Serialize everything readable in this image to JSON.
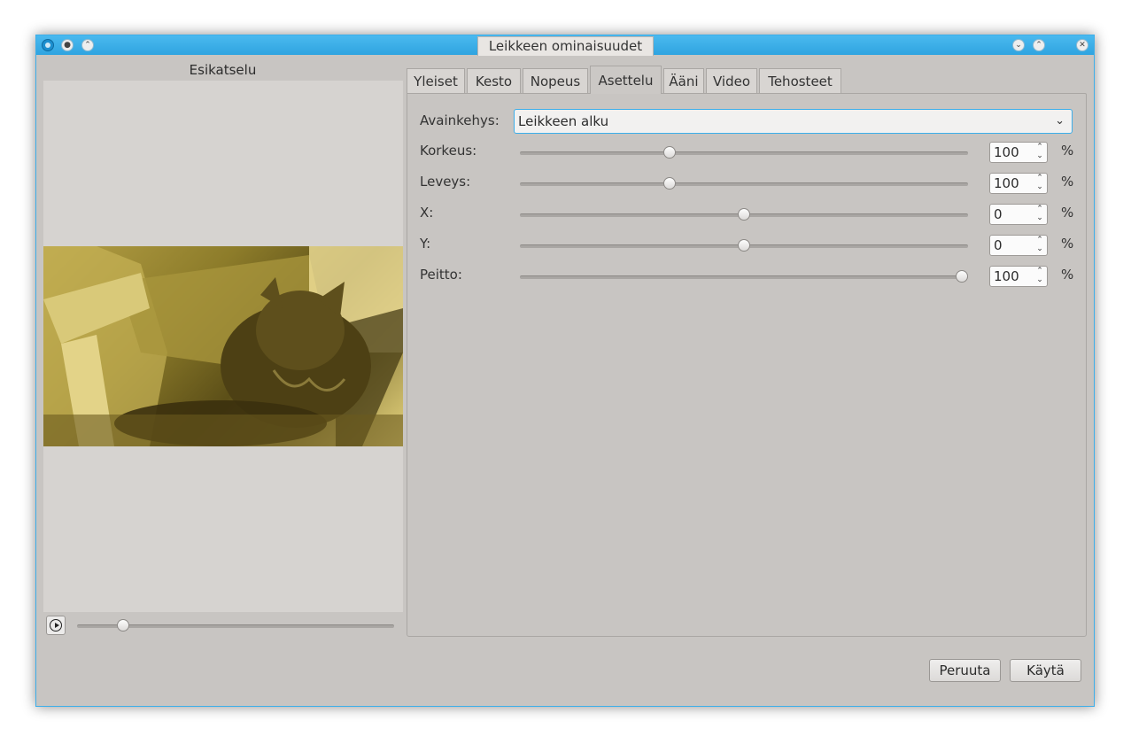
{
  "window": {
    "title": "Leikkeen ominaisuudet"
  },
  "preview": {
    "title": "Esikatselu",
    "play_label": "play",
    "position": 0.13
  },
  "tabs": [
    {
      "label": "Yleiset",
      "active": false
    },
    {
      "label": "Kesto",
      "active": false
    },
    {
      "label": "Nopeus",
      "active": false
    },
    {
      "label": "Asettelu",
      "active": true
    },
    {
      "label": "Ääni",
      "active": false
    },
    {
      "label": "Video",
      "active": false
    },
    {
      "label": "Tehosteet",
      "active": false
    }
  ],
  "keyframe": {
    "label": "Avainkehys:",
    "value": "Leikkeen alku"
  },
  "params": [
    {
      "label": "Korkeus:",
      "value": "100",
      "unit": "%",
      "slider": 0.33
    },
    {
      "label": "Leveys:",
      "value": "100",
      "unit": "%",
      "slider": 0.33
    },
    {
      "label": "X:",
      "value": "0",
      "unit": "%",
      "slider": 0.5
    },
    {
      "label": "Y:",
      "value": "0",
      "unit": "%",
      "slider": 0.5
    },
    {
      "label": "Peitto:",
      "value": "100",
      "unit": "%",
      "slider": 1.0
    }
  ],
  "buttons": {
    "cancel": "Peruuta",
    "apply": "Käytä"
  }
}
